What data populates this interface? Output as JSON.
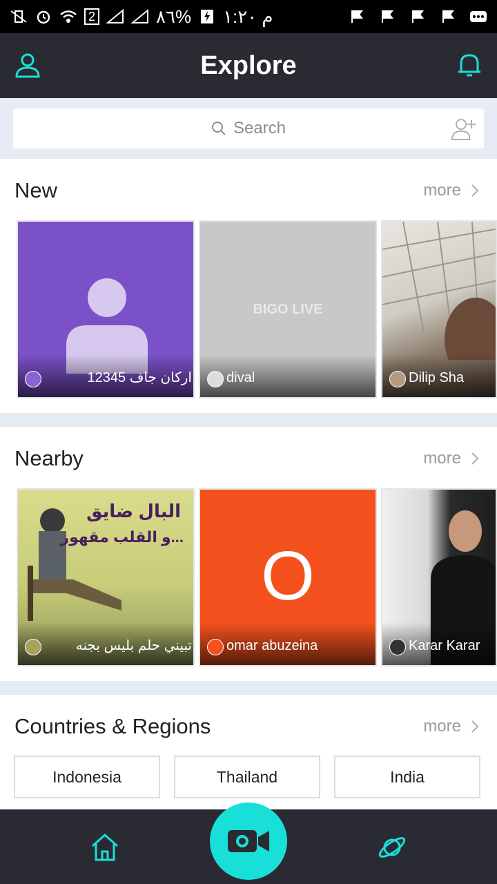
{
  "status_bar": {
    "time": "م ١:٢٠",
    "battery": "%٨٦",
    "sim": "2"
  },
  "header": {
    "title": "Explore"
  },
  "search": {
    "placeholder": "Search"
  },
  "sections": {
    "new": {
      "title": "New",
      "more": "more",
      "tiles": [
        {
          "label": "اركان جاف 12345"
        },
        {
          "label": "dival",
          "watermark": "BIGO LIVE"
        },
        {
          "label": "Dilip Sha"
        }
      ]
    },
    "nearby": {
      "title": "Nearby",
      "more": "more",
      "tiles": [
        {
          "label": "تبيني حلم بليس بجنه",
          "overlay_line1": "البال ضايق",
          "overlay_line2": "و القلب مقهور..."
        },
        {
          "label": "omar abuzeina",
          "initial": "O"
        },
        {
          "label": "Karar Karar"
        }
      ]
    },
    "countries": {
      "title": "Countries & Regions",
      "more": "more",
      "items": [
        "Indonesia",
        "Thailand",
        "India"
      ]
    }
  },
  "colors": {
    "accent": "#18e0d8",
    "header_bg": "#2a2b32",
    "purple_tile": "#7b51c8",
    "orange_tile": "#f4511e"
  },
  "icons": {
    "header_left": "profile-icon",
    "header_right": "bell-icon",
    "search": "search-icon",
    "search_right": "add-user-icon",
    "nav": [
      "home-icon",
      "video-camera-icon",
      "planet-icon"
    ]
  }
}
